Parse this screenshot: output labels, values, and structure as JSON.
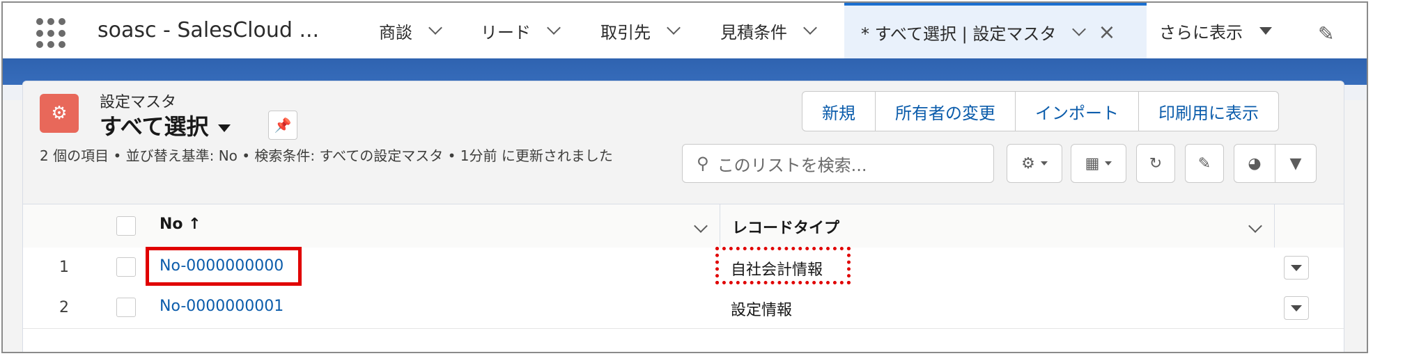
{
  "app": {
    "name": "soasc - SalesCloud ..."
  },
  "nav": {
    "items": [
      {
        "label": "商談"
      },
      {
        "label": "リード"
      },
      {
        "label": "取引先"
      },
      {
        "label": "見積条件"
      },
      {
        "label": "* すべて選択 | 設定マスタ"
      },
      {
        "label": "さらに表示"
      }
    ]
  },
  "header": {
    "object_label": "設定マスタ",
    "list_view": "すべて選択",
    "meta": "2 個の項目 • 並び替え基準: No • 検索条件: すべての設定マスタ • 1分前 に更新されました"
  },
  "actions": {
    "new": "新規",
    "change_owner": "所有者の変更",
    "import": "インポート",
    "print": "印刷用に表示"
  },
  "search": {
    "placeholder": "このリストを検索..."
  },
  "table": {
    "columns": [
      {
        "label": "No ↑"
      },
      {
        "label": "レコードタイプ"
      }
    ],
    "rows": [
      {
        "index": "1",
        "no": "No-0000000000",
        "record_type": "自社会計情報"
      },
      {
        "index": "2",
        "no": "No-0000000001",
        "record_type": "設定情報"
      }
    ]
  },
  "colors": {
    "highlight": "#e00000",
    "link": "#0b5cab",
    "icon_bg": "#e8685a",
    "active_tab": "#1b6fd0"
  },
  "icons": [
    "app-launcher-icon",
    "chevron-down-icon",
    "close-icon",
    "edit-icon",
    "settings-icon",
    "pin-icon",
    "search-icon",
    "gear-icon",
    "table-icon",
    "refresh-icon",
    "chart-icon",
    "filter-icon",
    "sort-asc-icon"
  ]
}
